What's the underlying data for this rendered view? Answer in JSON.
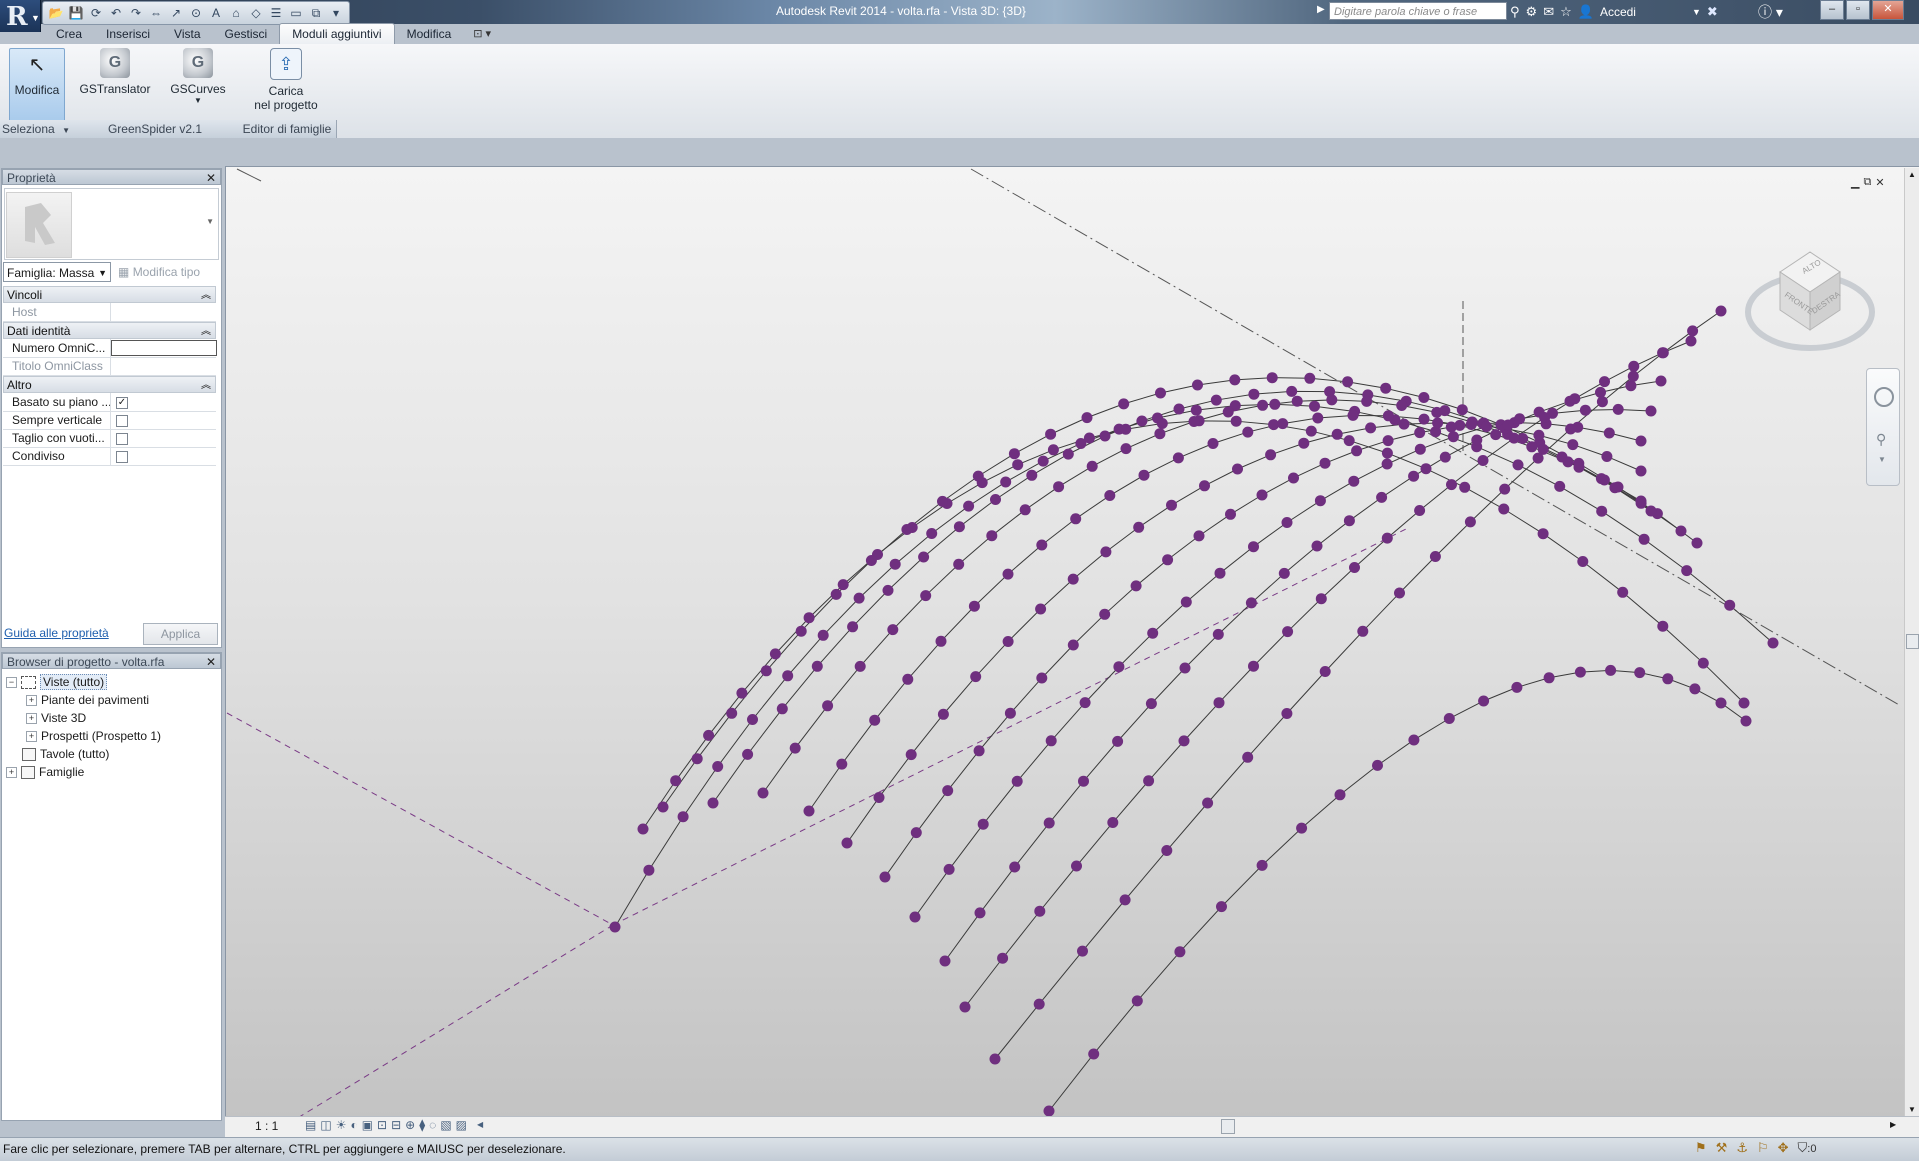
{
  "app": {
    "title": "Autodesk Revit 2014 -     volta.rfa - Vista 3D: {3D}",
    "search_placeholder": "Digitare parola chiave o frase",
    "signin": "Accedi"
  },
  "ribbon": {
    "tabs": [
      {
        "label": "Crea",
        "active": false
      },
      {
        "label": "Inserisci",
        "active": false
      },
      {
        "label": "Vista",
        "active": false
      },
      {
        "label": "Gestisci",
        "active": false
      },
      {
        "label": "Moduli aggiuntivi",
        "active": true
      },
      {
        "label": "Modifica",
        "active": false
      }
    ],
    "buttons": {
      "modifica": "Modifica",
      "gstranslator": "GSTranslator",
      "gscurves": "GSCurves",
      "carica_l1": "Carica",
      "carica_l2": "nel progetto"
    },
    "panels": {
      "seleziona": "Seleziona",
      "greenspider": "GreenSpider v2.1",
      "editor": "Editor di famiglie"
    }
  },
  "properties": {
    "title": "Proprietà",
    "family_combo": "Famiglia: Massa",
    "edit_type": "Modifica tipo",
    "groups": {
      "vincoli": "Vincoli",
      "dati": "Dati identità",
      "altro": "Altro"
    },
    "rows": {
      "host": "Host",
      "numero": "Numero OmniC...",
      "titolo": "Titolo OmniClass",
      "basato": "Basato su piano ...",
      "sempre": "Sempre verticale",
      "taglio": "Taglio con vuoti...",
      "condiviso": "Condiviso"
    },
    "checks": {
      "basato": true,
      "sempre": false,
      "taglio": false,
      "condiviso": false
    },
    "help_link": "Guida alle proprietà",
    "apply": "Applica"
  },
  "browser": {
    "title": "Browser di progetto - volta.rfa",
    "items": {
      "viste": "Viste (tutto)",
      "piante": "Piante dei pavimenti",
      "viste3d": "Viste 3D",
      "prospetti": "Prospetti (Prospetto 1)",
      "tavole": "Tavole (tutto)",
      "famiglie": "Famiglie"
    }
  },
  "viewport": {
    "scale": "1 : 1",
    "curve_color": "#6f2f7f",
    "viewcube_faces": {
      "top": "ALTO",
      "front": "FRONTE",
      "right": "DESTRA"
    }
  },
  "status": {
    "text": "Fare clic per selezionare, premere TAB per alternare, CTRL per aggiungere e MAIUSC per deselezionare.",
    "filter_count": ":0"
  }
}
